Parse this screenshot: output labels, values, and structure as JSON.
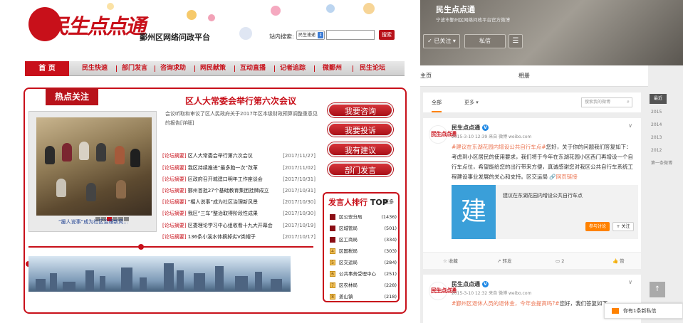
{
  "left": {
    "logo_text": "民生点点通",
    "site_name": "鄞州区网络问政平台",
    "search": {
      "label": "站内搜索:",
      "select_value": "民生速递",
      "button": "搜索"
    },
    "nav": {
      "home": "首 页",
      "items": [
        "民生快速",
        "部门发言",
        "咨询求助",
        "网民献策",
        "互动直播",
        "记者追踪",
        "微鄞州",
        "民生论坛"
      ]
    },
    "hot": {
      "tab": "热点关注",
      "headline": "区人大常委会举行第六次会议",
      "summary": "会议听取和审议了区人民政府关于2017年区本级财政预算调整重意见的报告[详细]",
      "photo_caption": "“援人说事”成为社区治理新风...",
      "news": [
        {
          "tag": "[论坛摘要]",
          "title": "区人大常委会举行第六次会议",
          "date": "[2017/11/27]"
        },
        {
          "tag": "[论坛摘要]",
          "title": "我区持续推进“最多跑一次”改革",
          "date": "[2017/11/02]"
        },
        {
          "tag": "[论坛摘要]",
          "title": "区政府召开城建口明年工作座谈会",
          "date": "[2017/10/31]"
        },
        {
          "tag": "[论坛摘要]",
          "title": "鄞州首批27个基础教育集团挂牌成立",
          "date": "[2017/10/31]"
        },
        {
          "tag": "[论坛摘要]",
          "title": "“榴人说事”成为社区治理新风景",
          "date": "[2017/10/30]"
        },
        {
          "tag": "[论坛摘要]",
          "title": "我区“三车”整治取得阶段性成果",
          "date": "[2017/10/30]"
        },
        {
          "tag": "[论坛摘要]",
          "title": "区委理论学习中心组收看十九大开幕会",
          "date": "[2017/10/19]"
        },
        {
          "tag": "[论坛摘要]",
          "title": "136条小溪水体摘掉劣V类帽子",
          "date": "[2017/10/17]"
        }
      ]
    },
    "side_buttons": [
      "我要咨询",
      "我要投诉",
      "我有建议",
      "部门发言"
    ],
    "ranking": {
      "title": "发言人排行",
      "title_suffix": "TOP",
      "more": "更多",
      "rows": [
        {
          "rank": "1",
          "name": "区公安分局",
          "value": "(1436)"
        },
        {
          "rank": "2",
          "name": "区城管局",
          "value": "(501)"
        },
        {
          "rank": "3",
          "name": "区工商局",
          "value": "(334)"
        },
        {
          "rank": "4",
          "name": "区国税局",
          "value": "(303)"
        },
        {
          "rank": "5",
          "name": "区交运局",
          "value": "(284)"
        },
        {
          "rank": "6",
          "name": "公共事务受理中心",
          "value": "(251)"
        },
        {
          "rank": "7",
          "name": "区农林局",
          "value": "(228)"
        },
        {
          "rank": "8",
          "name": "姜山镇",
          "value": "(218)"
        }
      ]
    }
  },
  "right": {
    "title": "民生点点通",
    "subtitle": "宁波市鄞州区网络问政平台官方微博",
    "follow": "✓ 已关注 ▾",
    "message": "私信",
    "menu": "☰",
    "tabs": [
      "主页",
      "相册"
    ],
    "feed": {
      "all": "全部",
      "more": "更多 ▾",
      "search_placeholder": "搜索我的微博"
    },
    "years": {
      "recent": "最近",
      "list": [
        "2015",
        "2014",
        "2013",
        "2012"
      ],
      "first": "第一条微博"
    },
    "posts": [
      {
        "avatar": "民生点点通",
        "name": "民生点点通",
        "meta": "2015-3-10 12:39 来自 微博 weibo.com",
        "hashtag": "#建议在东湖花园内增设公共自行车点#",
        "text": "您好，关于你的问题我们答复如下：考虑到小区居民的使用要求，我们将于今年在东湖花园小区西门再增设一个自行车点位，希望能给您的出行带来方便，真诚感谢您对我区公共自行车系统工程建设事业发展的关心和支持。区交运局",
        "link": "🔗网页链接",
        "card": {
          "icon": "建",
          "title": "建议在东湖花园内增设公共自行车点",
          "join": "参与讨论",
          "follow": "+ 关注"
        },
        "actions": {
          "fav": "☆ 收藏",
          "repost": "↗ 转发",
          "comment": "▭ 2",
          "like": "👍 赞"
        }
      },
      {
        "avatar": "民生点点通",
        "name": "民生点点通",
        "meta": "2015-3-10 12:32 来自 微博 weibo.com",
        "hashtag": "#鄞州区退休人员的退休金，今年会提高吗?#",
        "text": "您好，我们答复如下"
      }
    ],
    "top_button": "↑",
    "toast": "你有1条新私信"
  }
}
